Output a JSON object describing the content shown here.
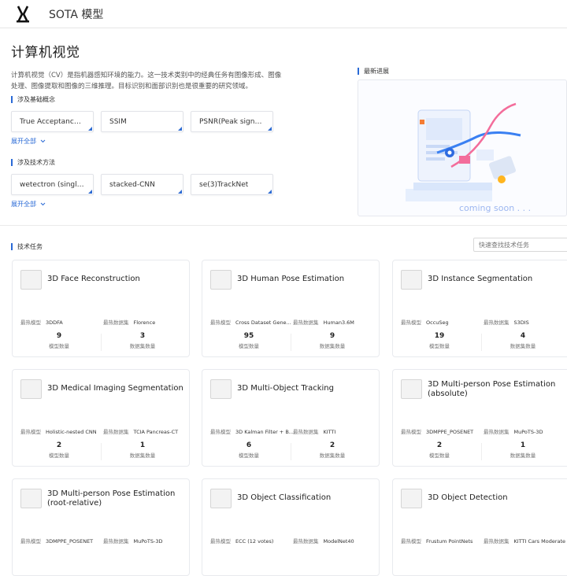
{
  "header": {
    "title": "SOTA 模型"
  },
  "intro": {
    "heading": "计算机视觉",
    "description": "计算机视觉（CV）是指机器感知环境的能力。这一技术类别中的经典任务有图像形成、图像处理、图像提取和图像的三维推理。目标识别和面部识别也是很重要的研究领域。"
  },
  "concepts": {
    "label": "涉及基础概念",
    "items": [
      "True Acceptance R...",
      "SSIM",
      "PSNR(Peak signal..."
    ],
    "expand": "展开全部"
  },
  "methods": {
    "label": "涉及技术方法",
    "items": [
      "wetectron (single ...",
      "stacked-CNN",
      "se(3)TrackNet"
    ],
    "expand": "展开全部"
  },
  "news": {
    "label": "最新进展",
    "placeholder_text": "coming soon . . ."
  },
  "tasks": {
    "label": "技术任务",
    "search_placeholder": "快速查找技术任务",
    "model_label": "最热模型",
    "dataset_label": "最热数据集",
    "model_count_label": "模型数量",
    "dataset_count_label": "数据集数量",
    "cards": [
      {
        "title": "3D Face Reconstruction",
        "model": "3DDFA",
        "dataset": "Florence",
        "models": "9",
        "datasets": "3"
      },
      {
        "title": "3D Human Pose Estimation",
        "model": "Cross Dataset Gene...",
        "dataset": "Human3.6M",
        "models": "95",
        "datasets": "9"
      },
      {
        "title": "3D Instance Segmentation",
        "model": "OccuSeg",
        "dataset": "S3DIS",
        "models": "19",
        "datasets": "4"
      },
      {
        "title": "3D Medical Imaging Segmentation",
        "model": "Holistic-nested CNN",
        "dataset": "TCIA Pancreas-CT",
        "models": "2",
        "datasets": "1"
      },
      {
        "title": "3D Multi-Object Tracking",
        "model": "3D Kalman Filter + B...",
        "dataset": "KITTI",
        "models": "6",
        "datasets": "2"
      },
      {
        "title": "3D Multi-person Pose Estimation (absolute)",
        "model": "3DMPPE_POSENET",
        "dataset": "MuPoTS-3D",
        "models": "2",
        "datasets": "1"
      },
      {
        "title": "3D Multi-person Pose Estimation (root-relative)",
        "model": "3DMPPE_POSENET",
        "dataset": "MuPoTS-3D",
        "models": "",
        "datasets": ""
      },
      {
        "title": "3D Object Classification",
        "model": "ECC (12 votes)",
        "dataset": "ModelNet40",
        "models": "",
        "datasets": ""
      },
      {
        "title": "3D Object Detection",
        "model": "Frustum PointNets",
        "dataset": "KITTI Cars Moderate",
        "models": "",
        "datasets": ""
      }
    ]
  }
}
